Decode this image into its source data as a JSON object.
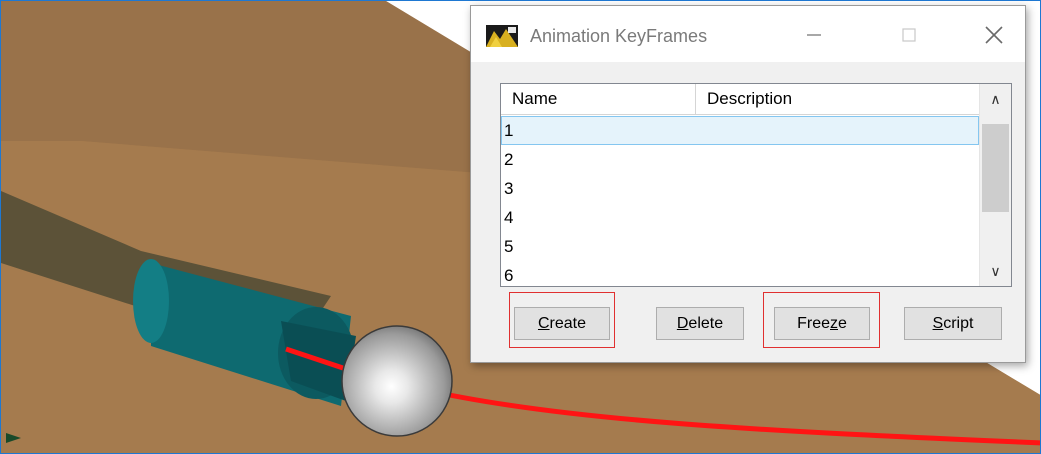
{
  "dialog": {
    "title": "Animation KeyFrames",
    "icon": "animation-app-icon"
  },
  "list": {
    "columns": [
      "Name",
      "Description"
    ],
    "rows": [
      {
        "name": "1",
        "description": ""
      },
      {
        "name": "2",
        "description": ""
      },
      {
        "name": "3",
        "description": ""
      },
      {
        "name": "4",
        "description": ""
      },
      {
        "name": "5",
        "description": ""
      },
      {
        "name": "6",
        "description": ""
      }
    ],
    "selected_row": "1"
  },
  "buttons": {
    "create": {
      "pre": "",
      "mnemonic": "C",
      "post": "reate"
    },
    "delete": {
      "pre": "",
      "mnemonic": "D",
      "post": "elete"
    },
    "freeze": {
      "pre": "Free",
      "mnemonic": "z",
      "post": "e"
    },
    "script": {
      "pre": "",
      "mnemonic": "S",
      "post": "cript"
    }
  },
  "highlighted_buttons": [
    "Create",
    "Freeze"
  ],
  "colors": {
    "highlight_box": "#e03030",
    "path_line": "#ff1414",
    "cylinder": "#0f6a70",
    "ground": "#a87a4a",
    "window_border": "#1e78d2"
  }
}
